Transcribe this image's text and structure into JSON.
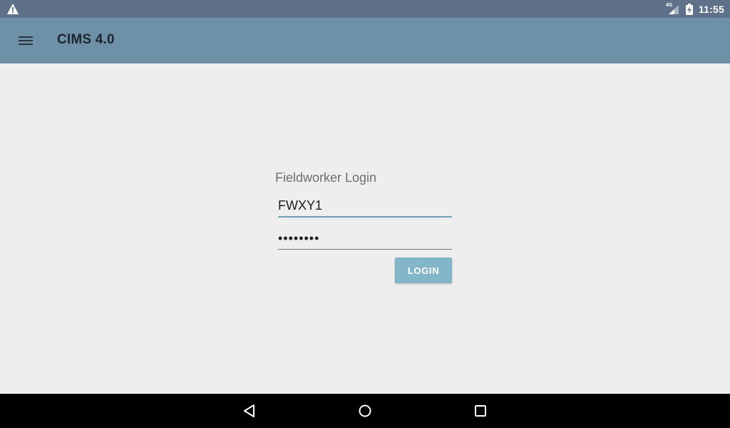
{
  "status_bar": {
    "time": "11:55",
    "network_type": "4G",
    "icons": [
      "warning-icon",
      "signal-icon",
      "battery-charging-icon"
    ]
  },
  "app_bar": {
    "title": "CIMS 4.0",
    "menu_icon": "hamburger-menu-icon"
  },
  "login": {
    "title": "Fieldworker Login",
    "username_value": "FWXY1",
    "password_value": "********",
    "button_label": "LOGIN"
  },
  "nav_bar": {
    "icons": [
      "back-icon",
      "home-icon",
      "recents-icon"
    ]
  },
  "colors": {
    "status_bar": "#5e7189",
    "app_bar": "#6e91a8",
    "background": "#eeeeee",
    "accent": "#6e9fb8",
    "button": "#82b6c8"
  }
}
